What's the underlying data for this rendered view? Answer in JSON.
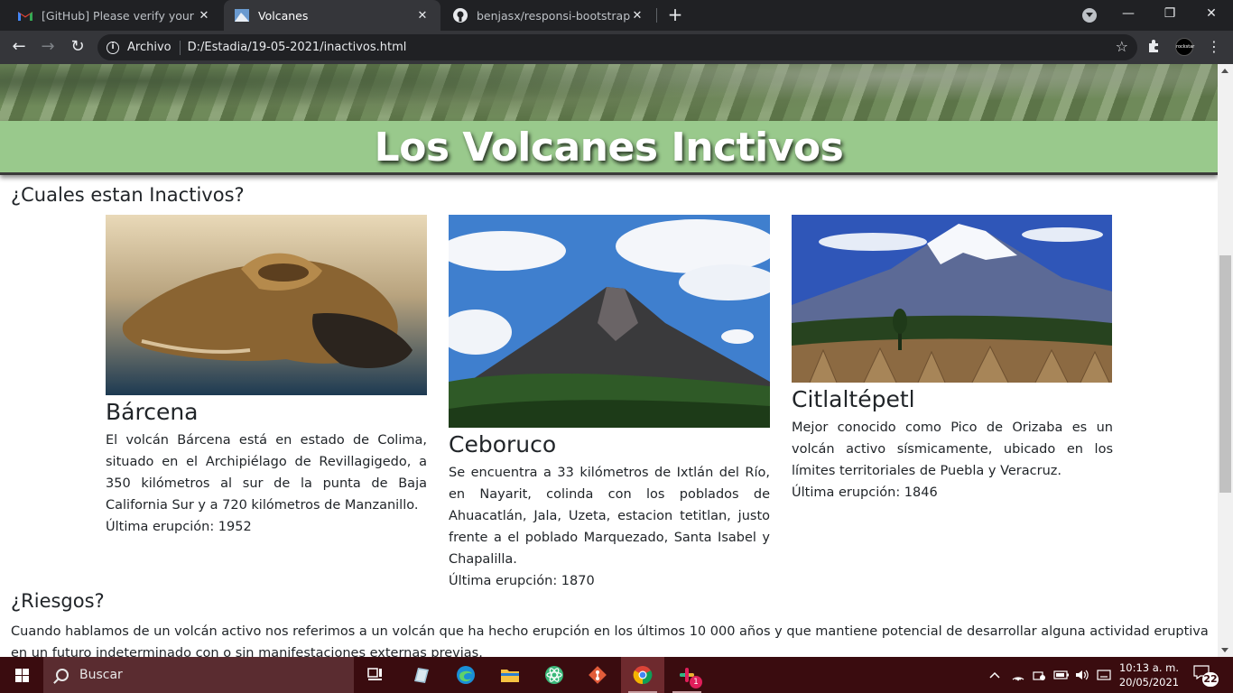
{
  "browser": {
    "tabs": [
      {
        "title": "[GitHub] Please verify your device",
        "icon": "gmail-icon",
        "active": false
      },
      {
        "title": "Volcanes",
        "icon": "volcano-favicon-icon",
        "active": true
      },
      {
        "title": "benjasx/responsi-bootstrap",
        "icon": "github-icon",
        "active": false
      }
    ],
    "new_tab": "+",
    "window_controls": {
      "minimize": "—",
      "restore": "❐",
      "close": "✕"
    },
    "nav": {
      "back": "←",
      "forward": "→",
      "reload": "↻"
    },
    "address": {
      "chip": "Archivo",
      "url": "D:/Estadia/19-05-2021/inactivos.html"
    },
    "profile_label": "rockstar",
    "menu": "⋮"
  },
  "page": {
    "banner_title": "Los Volcanes Inctivos",
    "section_inactive_title": "¿Cuales estan Inactivos?",
    "cards": [
      {
        "name": "Bárcena",
        "description": "El volcán Bárcena está en estado de Colima, situado en el Archipiélago de Revillagigedo, a 350 kilómetros al sur de la punta de Baja California Sur y a 720 kilómetros de Manzanillo.",
        "last_eruption": "Última erupción: 1952"
      },
      {
        "name": "Ceboruco",
        "description": "Se encuentra a 33 kilómetros de Ixtlán del Río, en Nayarit, colinda con los poblados de Ahuacatlán, Jala, Uzeta, estacion tetitlan, justo frente a el poblado Marquezado, Santa Isabel y Chapalilla.",
        "last_eruption": "Última erupción: 1870"
      },
      {
        "name": "Citlaltépetl",
        "description": "Mejor conocido como Pico de Orizaba es un volcán activo sísmicamente, ubicado en los límites territoriales de Puebla y Veracruz.",
        "last_eruption": "Última erupción: 1846"
      }
    ],
    "section_risks_title": "¿Riesgos?",
    "risks_text": "Cuando hablamos de un volcán activo nos referimos a un volcán que ha hecho erupción en los últimos 10 000 años y que mantiene potencial de desarrollar alguna actividad eruptiva en un futuro indeterminado con o sin manifestaciones externas previas."
  },
  "taskbar": {
    "search_placeholder": "Buscar",
    "clock_time": "10:13 a. m.",
    "clock_date": "20/05/2021",
    "notifications_count": "22",
    "slack_badge": "1",
    "tray_chevron": "^"
  },
  "colors": {
    "banner_bg": "#99c98c",
    "tab_strip": "#202124",
    "toolbar": "#35363a",
    "taskbar": "#3a0c0f"
  }
}
